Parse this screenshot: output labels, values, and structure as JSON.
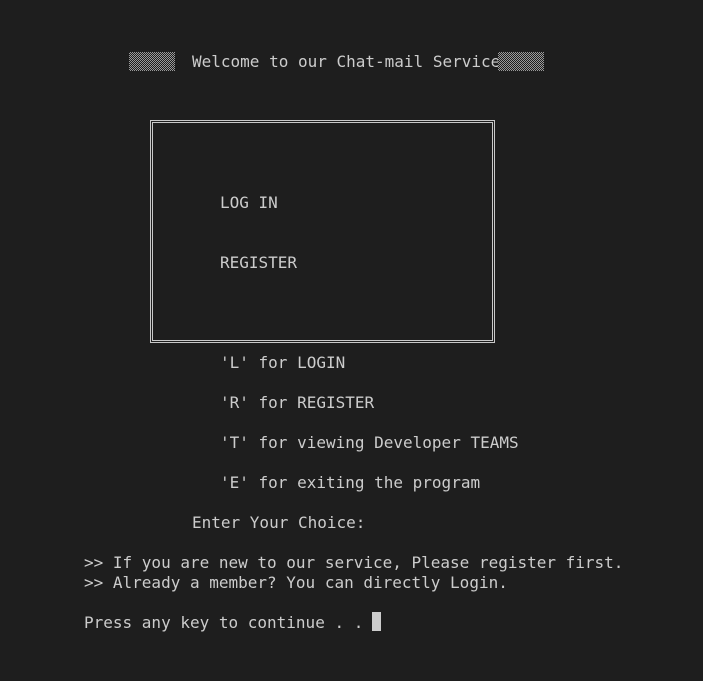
{
  "welcome": {
    "title": "Welcome to our Chat-mail Service"
  },
  "menu": {
    "login_label": "LOG IN",
    "register_label": "REGISTER"
  },
  "options": [
    "'L' for LOGIN",
    "'R' for REGISTER",
    "'T' for viewing Developer TEAMS",
    "'E' for exiting the program"
  ],
  "prompt": "Enter Your Choice:",
  "messages": [
    ">> If you are new to our service, Please register first.",
    ">> Already a member? You can directly Login."
  ],
  "continue_prompt": "Press any key to continue . . .",
  "colors": {
    "background": "#1e1e1e",
    "text": "#cccccc",
    "border": "#c8c8c8"
  }
}
